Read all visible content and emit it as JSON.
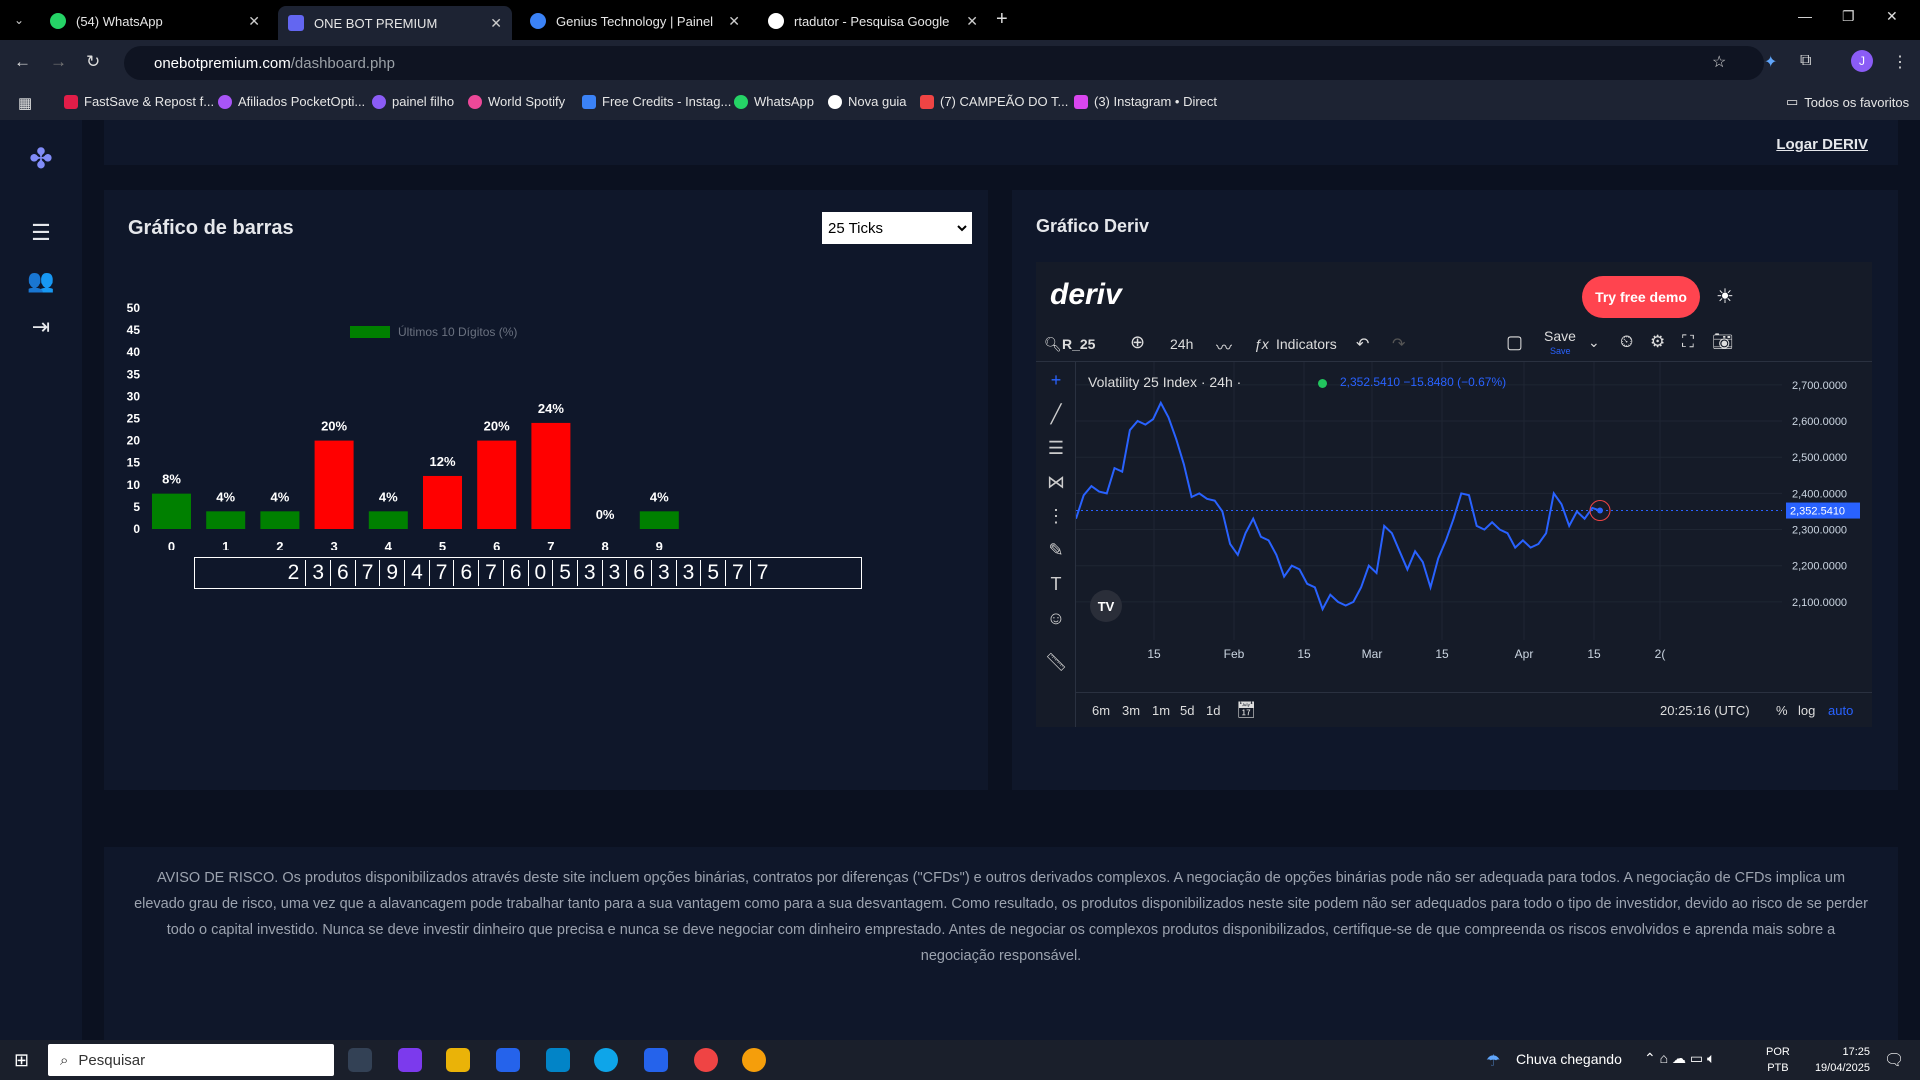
{
  "browser": {
    "tabs": [
      {
        "title": "(54) WhatsApp",
        "color": "#25D366"
      },
      {
        "title": "ONE BOT PREMIUM",
        "color": "#6366f1"
      },
      {
        "title": "Genius Technology | Painel",
        "color": "#3b82f6"
      },
      {
        "title": "rtadutor - Pesquisa Google",
        "color": "#ffffff"
      }
    ],
    "url_host": "onebotpremium.com",
    "url_path": "/dashboard.php",
    "bookmarks": [
      {
        "label": "FastSave & Repost f...",
        "color": "#e11d48"
      },
      {
        "label": "Afiliados PocketOpti...",
        "color": "#a855f7"
      },
      {
        "label": "painel filho",
        "color": "#8b5cf6"
      },
      {
        "label": "World Spotify",
        "color": "#ec4899"
      },
      {
        "label": "Free Credits - Instag...",
        "color": "#3b82f6"
      },
      {
        "label": "WhatsApp",
        "color": "#25D366"
      },
      {
        "label": "Nova guia",
        "color": "#ffffff"
      },
      {
        "label": "(7) CAMPEÃO DO T...",
        "color": "#ef4444"
      },
      {
        "label": "(3) Instagram • Direct",
        "color": "#d946ef"
      }
    ],
    "all_bookmarks": "Todos os favoritos",
    "profile_initial": "J"
  },
  "header": {
    "login_link": "Logar DERIV"
  },
  "bar_chart_panel": {
    "title": "Gráfico de barras",
    "tick_selected": "25 Ticks",
    "digits": [
      "2",
      "3",
      "6",
      "7",
      "9",
      "4",
      "7",
      "6",
      "7",
      "6",
      "0",
      "5",
      "3",
      "3",
      "6",
      "3",
      "3",
      "5",
      "7",
      "7"
    ]
  },
  "chart_data": {
    "type": "bar",
    "categories": [
      "0",
      "1",
      "2",
      "3",
      "4",
      "5",
      "6",
      "7",
      "8",
      "9"
    ],
    "series": [
      {
        "name": "Últimos 10 Dígitos (%)",
        "values": [
          8,
          4,
          4,
          20,
          4,
          12,
          20,
          24,
          0,
          4
        ]
      }
    ],
    "data_labels": [
      "8%",
      "4%",
      "4%",
      "20%",
      "4%",
      "12%",
      "20%",
      "24%",
      "0%",
      "4%"
    ],
    "bar_colors": [
      "#008000",
      "#008000",
      "#008000",
      "#ff0000",
      "#008000",
      "#ff0000",
      "#ff0000",
      "#ff0000",
      "#008000",
      "#008000"
    ],
    "yticks": [
      0,
      5,
      10,
      15,
      20,
      25,
      30,
      35,
      40,
      45,
      50
    ],
    "ylim": [
      0,
      50
    ],
    "legend_position": "top"
  },
  "deriv_panel": {
    "title": "Gráfico Deriv",
    "logo": "deriv",
    "try_demo": "Try free demo",
    "symbol": "R_25",
    "interval": "24h",
    "indicators": "Indicators",
    "save": "Save",
    "save_sub": "Save",
    "instrument": "Volatility 25 Index · 24h ·",
    "quote": "2,352.5410 −15.8480 (−0.67%)",
    "last_price": "2,352.5410",
    "price_axis": [
      "2,700.0000",
      "2,600.0000",
      "2,500.0000",
      "2,400.0000",
      "2,300.0000",
      "2,200.0000",
      "2,100.0000"
    ],
    "time_axis": [
      "15",
      "Feb",
      "15",
      "Mar",
      "15",
      "Apr",
      "15",
      "2("
    ],
    "periods": [
      "6m",
      "3m",
      "1m",
      "5d",
      "1d"
    ],
    "clock": "20:25:16 (UTC)",
    "pct": "%",
    "log": "log",
    "auto": "auto",
    "line_color": "#2962ff"
  },
  "risk_notice": "AVISO DE RISCO. Os produtos disponibilizados através deste site incluem opções binárias, contratos por diferenças (\"CFDs\") e outros derivados complexos. A negociação de opções binárias pode não ser adequada para todos. A negociação de CFDs implica um elevado grau de risco, uma vez que a alavancagem pode trabalhar tanto para a sua vantagem como para a sua desvantagem. Como resultado, os produtos disponibilizados neste site podem não ser adequados para todo o tipo de investidor, devido ao risco de se perder todo o capital investido. Nunca se deve investir dinheiro que precisa e nunca se deve negociar com dinheiro emprestado. Antes de negociar os complexos produtos disponibilizados, certifique-se de que compreenda os riscos envolvidos e aprenda mais sobre a negociação responsável.",
  "taskbar": {
    "search": "Pesquisar",
    "weather": "Chuva chegando",
    "lang1": "POR",
    "lang2": "PTB",
    "time": "17:25",
    "date": "19/04/2025"
  }
}
